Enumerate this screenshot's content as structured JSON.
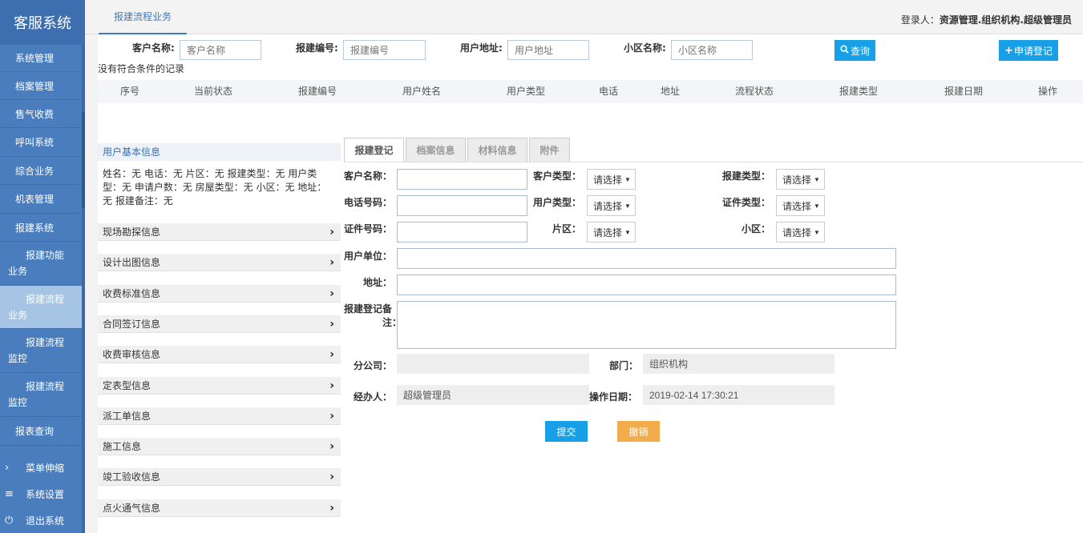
{
  "app": {
    "title": "客服系统"
  },
  "sidebar": {
    "items": [
      {
        "label": "系统管理"
      },
      {
        "label": "档案管理"
      },
      {
        "label": "售气收费"
      },
      {
        "label": "呼叫系统"
      },
      {
        "label": "综合业务"
      },
      {
        "label": "机表管理"
      },
      {
        "label": "报建系统"
      }
    ],
    "subitems": [
      {
        "line1": "报建功能",
        "line2": "业务"
      },
      {
        "line1": "报建流程",
        "line2": "业务"
      },
      {
        "line1": "报建流程",
        "line2": "监控"
      },
      {
        "line1": "报建流程",
        "line2": "监控"
      }
    ],
    "report": "报表查询",
    "bottom": [
      {
        "icon": "›",
        "label": "菜单伸缩"
      },
      {
        "icon": "≡",
        "label": "系统设置"
      },
      {
        "icon": "⏻",
        "label": "退出系统"
      }
    ]
  },
  "header": {
    "tab": "报建流程业务",
    "login_prefix": "登录人：",
    "login_user": "资源管理.组织机构.超级管理员"
  },
  "search": {
    "customer_label": "客户名称:",
    "customer_placeholder": "客户名称",
    "code_label": "报建编号:",
    "code_placeholder": "报建编号",
    "address_label": "用户地址:",
    "address_placeholder": "用户地址",
    "community_label": "小区名称:",
    "community_placeholder": "小区名称",
    "query_button": "查询",
    "apply_button": "申请登记"
  },
  "table": {
    "empty_text": "没有符合条件的记录",
    "columns": [
      "序号",
      "当前状态",
      "报建编号",
      "用户姓名",
      "用户类型",
      "电话",
      "地址",
      "流程状态",
      "报建类型",
      "报建日期",
      "操作"
    ]
  },
  "basic_info": {
    "title": "用户基本信息",
    "text": "姓名：无 电话：无 片区：无 报建类型：无 用户类型：无 申请户数：无 房屋类型：无 小区：无 地址：无 报建备注：无"
  },
  "accordion": [
    "现场勘探信息",
    "设计出图信息",
    "收费标准信息",
    "合同签订信息",
    "收费审核信息",
    "定表型信息",
    "派工单信息",
    "施工信息",
    "竣工验收信息",
    "点火通气信息"
  ],
  "form": {
    "tabs": [
      "报建登记",
      "档案信息",
      "材料信息",
      "附件"
    ],
    "labels": {
      "customer_name": "客户名称：",
      "phone": "电话号码：",
      "id_number": "证件号码：",
      "customer_type": "客户类型：",
      "user_type": "用户类型：",
      "area": "片区：",
      "apply_type": "报建类型：",
      "id_type": "证件类型：",
      "community": "小区：",
      "user_unit": "用户单位：",
      "address": "地址：",
      "remark_1": "报建登记备",
      "remark_2": "注：",
      "branch": "分公司：",
      "department": "部门：",
      "handler": "经办人：",
      "op_date": "操作日期："
    },
    "select_placeholder": "请选择",
    "department_value": "组织机构",
    "handler_value": "超级管理员",
    "op_date_value": "2019-02-14 17:30:21",
    "submit": "提交",
    "cancel": "撤销"
  }
}
